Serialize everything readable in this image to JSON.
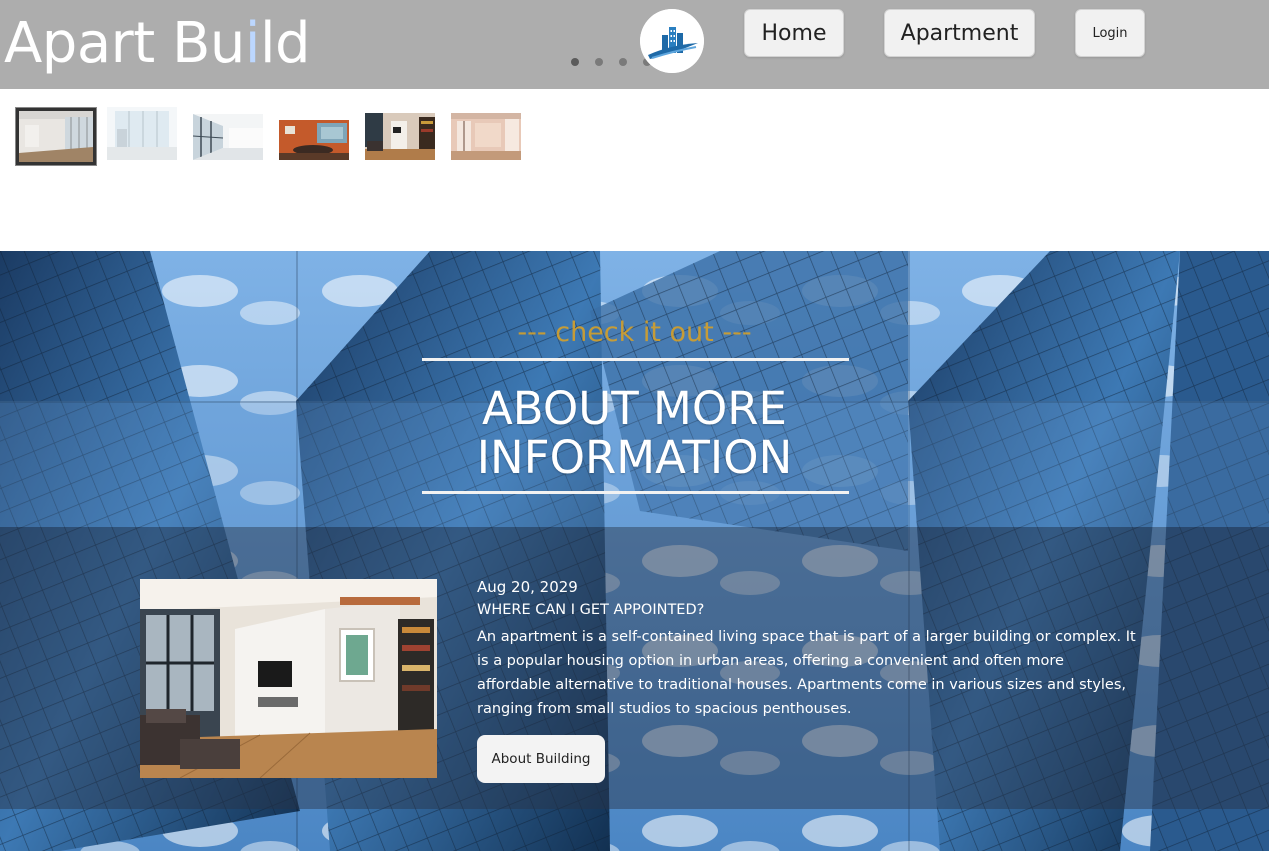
{
  "header": {
    "brand_prefix": "Apart Bu",
    "brand_accent": "i",
    "brand_suffix": "ld",
    "logo_icon": "building-logo-icon",
    "carousel_dots": 4,
    "nav": {
      "home_label": "Home",
      "apartment_label": "Apartment",
      "login_label": "Login"
    }
  },
  "gallery": {
    "thumbnails": [
      {
        "name": "empty-room-thumbnail",
        "selected": true
      },
      {
        "name": "bright-window-room-thumbnail",
        "selected": false
      },
      {
        "name": "white-corridor-thumbnail",
        "selected": false
      },
      {
        "name": "orange-office-thumbnail",
        "selected": false
      },
      {
        "name": "living-room-thumbnail",
        "selected": false
      },
      {
        "name": "pink-bedroom-thumbnail",
        "selected": false
      }
    ]
  },
  "hero": {
    "eyebrow": "--- check it out ---",
    "headline_line1": "ABOUT MORE",
    "headline_line2": "INFORMATION",
    "post": {
      "date": "Aug 20, 2029",
      "title": "WHERE CAN I GET APPOINTED?",
      "body": "An apartment is a self-contained living space that is part of a larger building or complex. It is a popular housing option in urban areas, offering a convenient and often more affordable alternative to traditional houses. Apartments come in various sizes and styles, ranging from small studios to spacious penthouses.",
      "button_label": "About Building"
    }
  },
  "colors": {
    "header_bg": "#adadad",
    "accent_gold": "#d4a02a",
    "logo_blue": "#1e6aa8"
  }
}
